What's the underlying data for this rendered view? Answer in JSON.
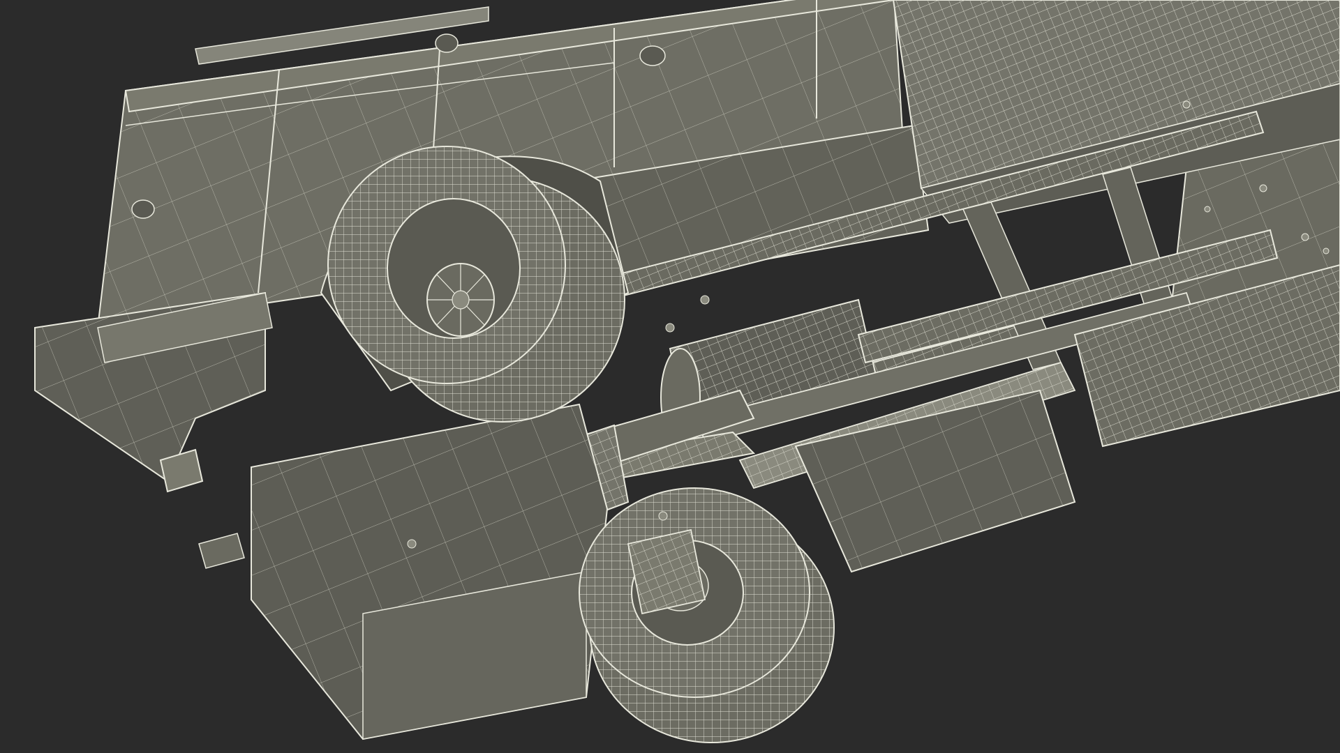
{
  "scene": {
    "background_color": "#2b2b2b",
    "surface_color": "#6e6e64",
    "surface_dark_color": "#5a5a52",
    "surface_light_color": "#86867a",
    "wire_color": "#e8e8dc",
    "wire_dim_color": "#bdbdb0",
    "subject": "wireframe-truck-underside"
  }
}
